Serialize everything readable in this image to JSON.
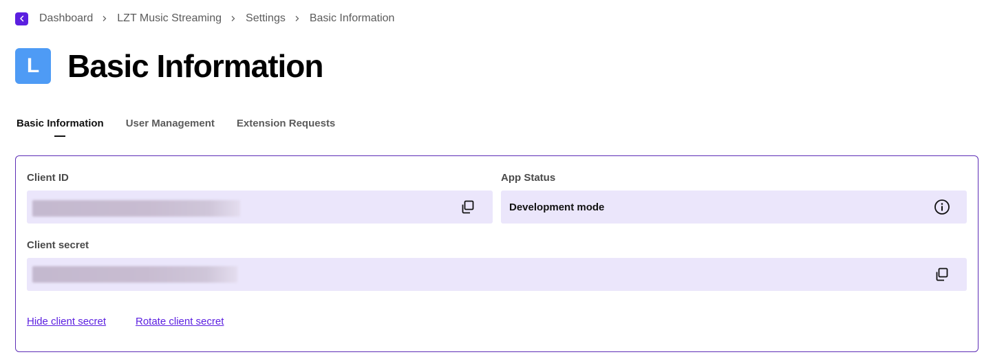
{
  "breadcrumb": {
    "items": [
      "Dashboard",
      "LZT Music Streaming",
      "Settings",
      "Basic Information"
    ]
  },
  "header": {
    "avatar_letter": "L",
    "title": "Basic Information"
  },
  "tabs": [
    {
      "label": "Basic Information",
      "active": true
    },
    {
      "label": "User Management",
      "active": false
    },
    {
      "label": "Extension Requests",
      "active": false
    }
  ],
  "card": {
    "client_id_label": "Client ID",
    "app_status_label": "App Status",
    "app_status_value": "Development mode",
    "client_secret_label": "Client secret",
    "hide_secret_link": "Hide client secret",
    "rotate_secret_link": "Rotate client secret"
  },
  "icons": {
    "back": "chevron-left-icon",
    "copy": "copy-icon",
    "info": "info-icon"
  },
  "colors": {
    "accent": "#5b1fe0",
    "avatar": "#4e9bf5",
    "field_bg": "#ebe6fb",
    "card_border": "#5b2bb5"
  }
}
